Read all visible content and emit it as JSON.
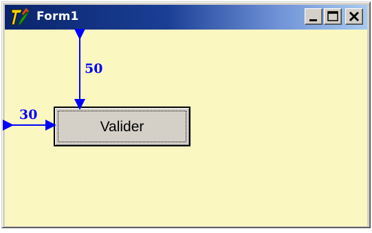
{
  "window": {
    "title": "Form1",
    "icon": "app-logo-icon",
    "controls": {
      "minimize_icon": "minimize-icon",
      "maximize_icon": "maximize-icon",
      "close_icon": "close-icon"
    }
  },
  "client": {
    "background_color": "#fbf7c0",
    "button": {
      "label": "Valider"
    }
  },
  "annotations": {
    "top_margin_label": "50",
    "left_margin_label": "30",
    "color": "#0000ff"
  }
}
